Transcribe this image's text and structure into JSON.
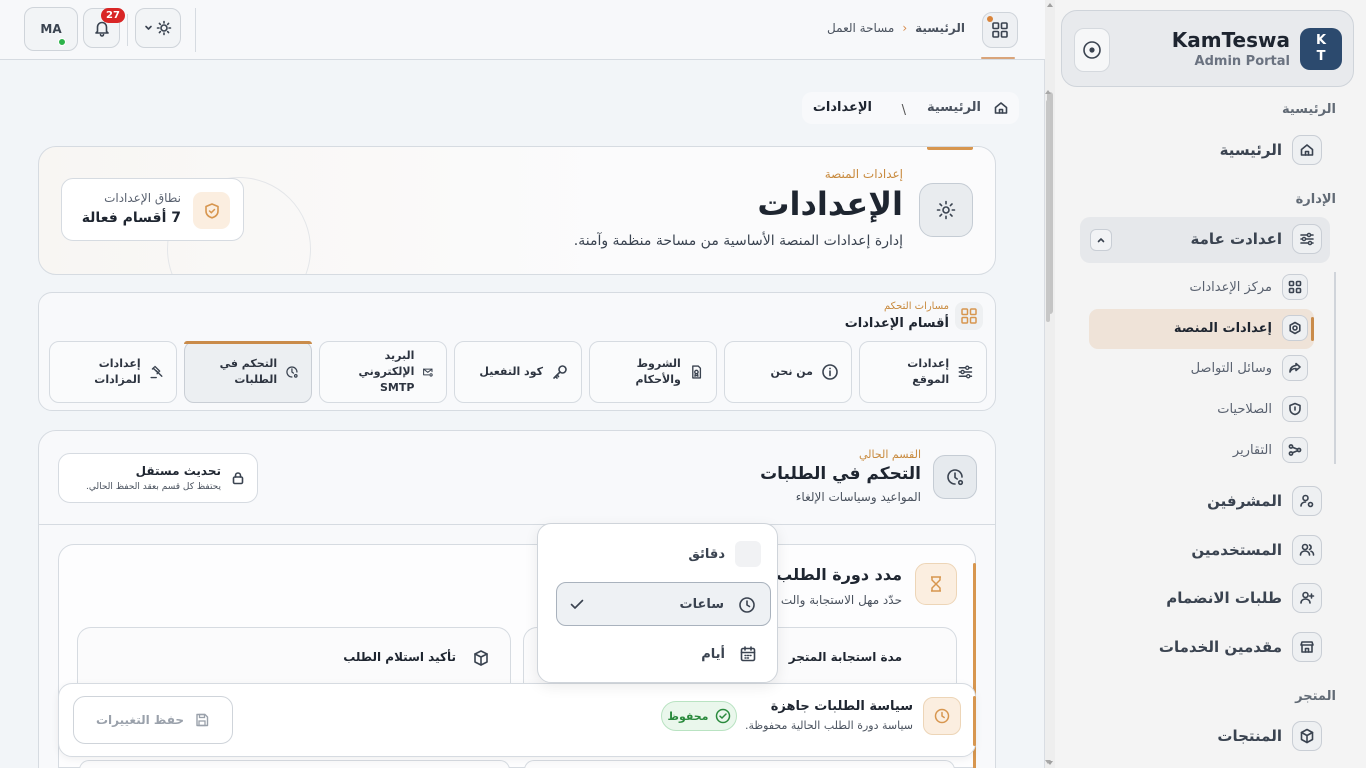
{
  "sidebar": {
    "brand": {
      "logo_line1": "K",
      "logo_line2": "T",
      "name": "KamTeswa",
      "subtitle": "Admin Portal"
    },
    "sections": {
      "home": "الرئيسية",
      "admin": "الإدارة",
      "store": "المتجر"
    },
    "items": {
      "home": "الرئيسية",
      "general_settings": "اعدادت عامة",
      "supervisors": "المشرفين",
      "users": "المستخدمين",
      "join_requests": "طلبات الانضمام",
      "providers": "مقدمين الخدمات",
      "products": "المنتجات"
    },
    "sub_items": {
      "settings_center": "مركز الإعدادات",
      "platform_settings": "إعدادات المنصة",
      "social": "وسائل التواصل",
      "permissions": "الصلاحيات",
      "reports": "التقارير"
    }
  },
  "topbar": {
    "breadcrumb_home": "الرئيسية",
    "breadcrumb_workspace": "مساحة العمل",
    "notifications_count": "27",
    "avatar_initials": "MA"
  },
  "page_breadcrumb": {
    "home": "الرئيسية",
    "separator": "\\",
    "current": "الإعدادات"
  },
  "hero": {
    "eyebrow": "إعدادات المنصة",
    "title": "الإعدادات",
    "description": "إدارة إعدادات المنصة الأساسية من مساحة منظمة وآمنة.",
    "scope_label": "نطاق الإعدادات",
    "scope_value": "7 أقسام فعالة"
  },
  "sections_nav": {
    "eyebrow": "مسارات التحكم",
    "title": "أقسام الإعدادات",
    "tabs": [
      {
        "label": "إعدادات الموقع",
        "icon": "sliders-icon"
      },
      {
        "label": "من نحن",
        "icon": "info-icon"
      },
      {
        "label": "الشروط والأحكام",
        "icon": "document-badge-icon"
      },
      {
        "label": "كود التفعيل",
        "icon": "key-icon"
      },
      {
        "label": "البريد الإلكتروني SMTP",
        "icon": "mail-settings-icon"
      },
      {
        "label": "التحكم في الطلبات",
        "icon": "clock-settings-icon",
        "active": true
      },
      {
        "label": "إعدادات المزادات",
        "icon": "gavel-icon"
      }
    ]
  },
  "current_section": {
    "eyebrow": "القسم الحالي",
    "title": "التحكم في الطلبات",
    "description": "المواعيد وسياسات الإلغاء",
    "independent_title": "تحديث مستقل",
    "independent_desc": "يحتفظ كل قسم بعقد الحفظ الحالي."
  },
  "cycle": {
    "title": "مدد دورة الطلب",
    "description": "حدّد مهل الاستجابة والت",
    "store_response_title": "مدة استجابة المتجر",
    "receipt_confirm_title": "تأكيد استلام الطلب"
  },
  "savebar": {
    "title": "سياسة الطلبات جاهزة",
    "description": "سياسة دورة الطلب الحالية محفوظة.",
    "saved_label": "محفوظ",
    "save_button": "حفظ التغييرات"
  },
  "dropdown": {
    "options": [
      {
        "label": "دقائق",
        "icon": "blank"
      },
      {
        "label": "ساعات",
        "icon": "clock-icon",
        "selected": true
      },
      {
        "label": "أيام",
        "icon": "calendar-icon"
      }
    ]
  },
  "colors": {
    "accent": "#d7964f",
    "brand": "#2c4a6e",
    "success": "#2a8a3d",
    "badge": "#d92626"
  }
}
